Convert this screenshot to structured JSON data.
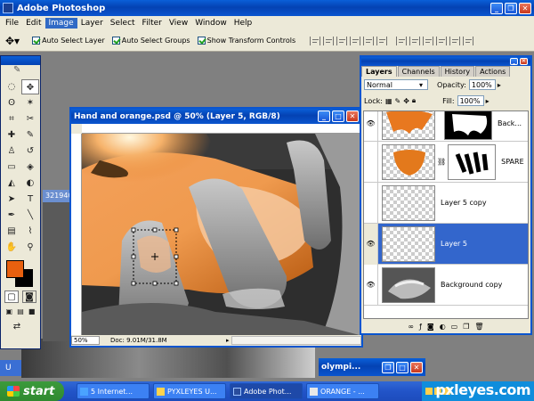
{
  "app": {
    "title": "Adobe Photoshop"
  },
  "menu": [
    "File",
    "Edit",
    "Image",
    "Layer",
    "Select",
    "Filter",
    "View",
    "Window",
    "Help"
  ],
  "options": {
    "auto_select_layer": "Auto Select Layer",
    "auto_select_groups": "Auto Select Groups",
    "show_transform_controls": "Show Transform Controls"
  },
  "document": {
    "title": "Hand and orange.psd @ 50% (Layer 5, RGB/8)",
    "zoom": "50%",
    "doc_size": "Doc: 9.01M/31.8M"
  },
  "background_tab": "321940",
  "olympic_window": "olympi...",
  "layers_panel": {
    "tabs": [
      "Layers",
      "Channels",
      "History",
      "Actions"
    ],
    "blend_mode": "Normal",
    "opacity_label": "Opacity:",
    "opacity": "100%",
    "lock_label": "Lock:",
    "fill_label": "Fill:",
    "fill": "100%",
    "layers": [
      {
        "name": "Back...",
        "visible": true,
        "active": false
      },
      {
        "name": "SPARE",
        "visible": false,
        "active": false
      },
      {
        "name": "Layer 5 copy",
        "visible": false,
        "active": false
      },
      {
        "name": "Layer 5",
        "visible": true,
        "active": true
      },
      {
        "name": "Background copy",
        "visible": true,
        "active": false
      }
    ]
  },
  "taskbar": {
    "start": "start",
    "tasks": [
      "5 Internet...",
      "PYXLEYES U...",
      "Adobe Phot...",
      "ORANGE - ..."
    ],
    "watermark": "pxleyes.com"
  },
  "colors": {
    "foreground": "#e8600f",
    "background": "#ffffff",
    "xp_blue": "#0a55cf",
    "selection": "#3366cc"
  }
}
